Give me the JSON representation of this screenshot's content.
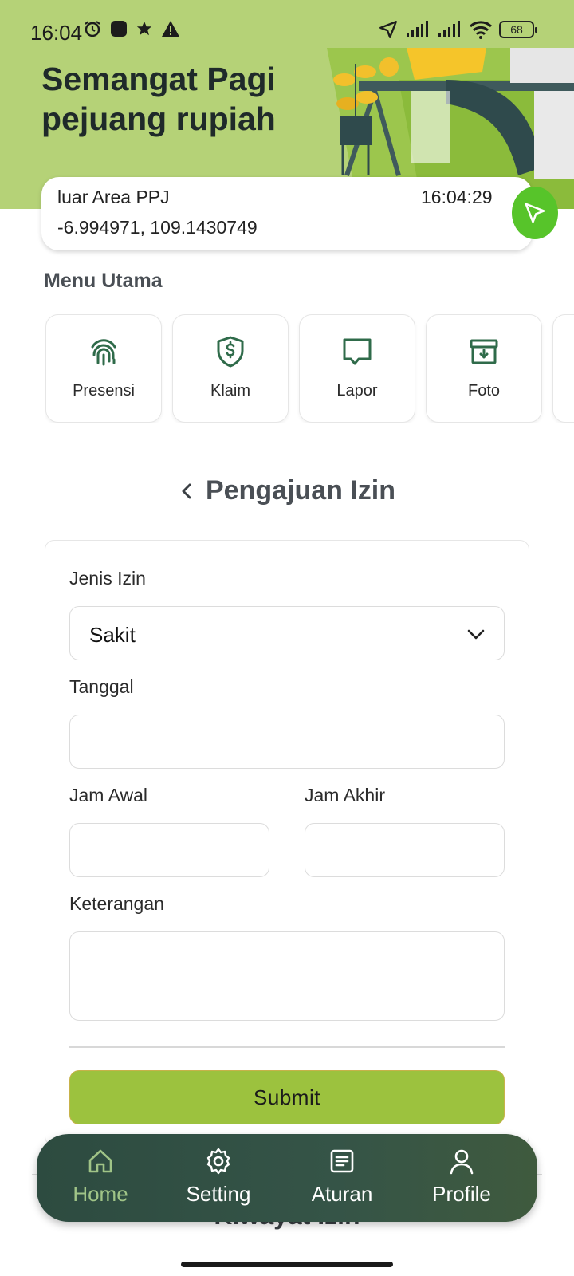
{
  "status_bar": {
    "time": "16:04",
    "battery": "68",
    "icons": [
      "alarm-icon",
      "app-icon",
      "star-icon",
      "warning-icon",
      "location-arrow-icon",
      "signal-icon",
      "signal-icon",
      "wifi-icon",
      "battery-icon"
    ]
  },
  "header": {
    "greeting": "Semangat Pagi pejuang rupiah",
    "background_color": "#b5d277"
  },
  "location": {
    "area": "luar Area PPJ",
    "time": "16:04:29",
    "coords": "-6.994971, 109.1430749",
    "button_color": "#57c42a"
  },
  "menu": {
    "title": "Menu Utama",
    "items": [
      {
        "label": "Presensi",
        "icon": "fingerprint-icon"
      },
      {
        "label": "Klaim",
        "icon": "dollar-shield-icon"
      },
      {
        "label": "Lapor",
        "icon": "chat-icon"
      },
      {
        "label": "Foto",
        "icon": "archive-download-icon"
      }
    ]
  },
  "page": {
    "title": "Pengajuan Izin"
  },
  "form": {
    "jenis_label": "Jenis Izin",
    "jenis_value": "Sakit",
    "tanggal_label": "Tanggal",
    "tanggal_value": "",
    "jam_awal_label": "Jam Awal",
    "jam_awal_value": "",
    "jam_akhir_label": "Jam Akhir",
    "jam_akhir_value": "",
    "keterangan_label": "Keterangan",
    "keterangan_value": "",
    "submit_label": "Submit",
    "accent_color": "#9cc23e"
  },
  "history": {
    "title": "Riwayat Izin"
  },
  "bottom_nav": {
    "items": [
      {
        "label": "Home",
        "icon": "home-icon",
        "active": true
      },
      {
        "label": "Setting",
        "icon": "gear-icon",
        "active": false
      },
      {
        "label": "Aturan",
        "icon": "document-icon",
        "active": false
      },
      {
        "label": "Profile",
        "icon": "user-icon",
        "active": false
      }
    ],
    "active_color": "#a0c487"
  }
}
